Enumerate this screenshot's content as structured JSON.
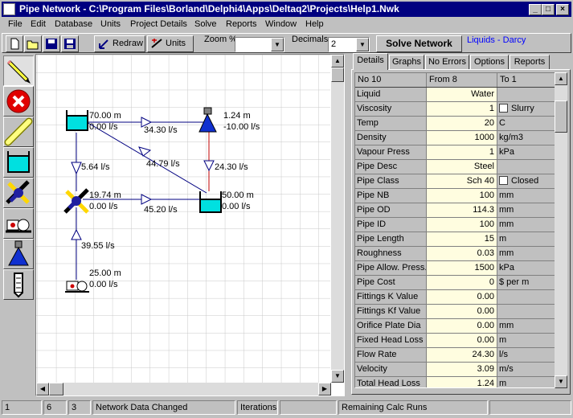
{
  "window": {
    "title": "Pipe Network - C:\\Program Files\\Borland\\Delphi4\\Apps\\Deltaq2\\Projects\\Help1.Nwk",
    "buttons": [
      "_",
      "□",
      "×"
    ]
  },
  "menu": [
    "File",
    "Edit",
    "Database",
    "Units",
    "Project Details",
    "Solve",
    "Reports",
    "Window",
    "Help"
  ],
  "toolbar": {
    "redraw_label": "Redraw",
    "units_label": "Units",
    "zoom_label": "Zoom %",
    "zoom_value": "",
    "decimals_label": "Decimals",
    "decimals_value": "2",
    "solve_label": "Solve Network",
    "mode_text": "Liquids - Darcy"
  },
  "palette": [
    "pencil-tool",
    "delete-tool",
    "pipe-tool",
    "tank-tool",
    "node-tool",
    "pump-tool",
    "sprinkler-tool",
    "well-tool"
  ],
  "network": {
    "tank_top_left": {
      "head": "70.00 m",
      "flow": "0.00 l/s"
    },
    "sprinkler": {
      "head": "1.24 m",
      "flow": "-10.00 l/s"
    },
    "node_mid": {
      "head": "19.74 m",
      "flow": "0.00 l/s"
    },
    "tank_right": {
      "head": "50.00 m",
      "flow": "0.00 l/s"
    },
    "pump": {
      "head": "25.00 m",
      "flow": "0.00 l/s"
    },
    "pipes": {
      "top": "34.30 l/s",
      "diagonal": "44.79 l/s",
      "left_vertical": "5.64 l/s",
      "right_vertical": "24.30 l/s",
      "middle": "45.20 l/s",
      "bottom": "39.55 l/s"
    }
  },
  "tabs": [
    "Details",
    "Graphs",
    "No Errors",
    "Options",
    "Reports"
  ],
  "grid": {
    "header": [
      "No 10",
      "From 8",
      "To 1"
    ],
    "rows": [
      {
        "name": "Liquid",
        "value": "Water",
        "unit": ""
      },
      {
        "name": "Viscosity",
        "value": "1",
        "unit": "Slurry",
        "check": true
      },
      {
        "name": "Temp",
        "value": "20",
        "unit": "C"
      },
      {
        "name": "Density",
        "value": "1000",
        "unit": "kg/m3"
      },
      {
        "name": "Vapour Press",
        "value": "1",
        "unit": "kPa"
      },
      {
        "name": "Pipe Desc",
        "value": "Steel",
        "unit": ""
      },
      {
        "name": "Pipe Class",
        "value": "Sch 40",
        "unit": "Closed",
        "check": true
      },
      {
        "name": "Pipe NB",
        "value": "100",
        "unit": "mm"
      },
      {
        "name": "Pipe OD",
        "value": "114.3",
        "unit": "mm"
      },
      {
        "name": "Pipe ID",
        "value": "100",
        "unit": "mm"
      },
      {
        "name": "Pipe Length",
        "value": "15",
        "unit": "m"
      },
      {
        "name": "Roughness",
        "value": "0.03",
        "unit": "mm"
      },
      {
        "name": "Pipe Allow. Press.",
        "value": "1500",
        "unit": "kPa"
      },
      {
        "name": "Pipe Cost",
        "value": "0",
        "unit": "$ per m"
      },
      {
        "name": "Fittings K Value",
        "value": "0.00",
        "unit": ""
      },
      {
        "name": "Fittings Kf Value",
        "value": "0.00",
        "unit": ""
      },
      {
        "name": "Orifice Plate Dia",
        "value": "0.00",
        "unit": "mm"
      },
      {
        "name": "Fixed Head Loss",
        "value": "0.00",
        "unit": "m"
      },
      {
        "name": "Flow Rate",
        "value": "24.30",
        "unit": "l/s"
      },
      {
        "name": "Velocity",
        "value": "3.09",
        "unit": "m/s"
      },
      {
        "name": "Total Head Loss",
        "value": "1.24",
        "unit": "m"
      }
    ]
  },
  "status": [
    "1",
    "6",
    "3",
    "Network Data Changed",
    "Iterations",
    "",
    "Remaining Calc Runs",
    ""
  ]
}
